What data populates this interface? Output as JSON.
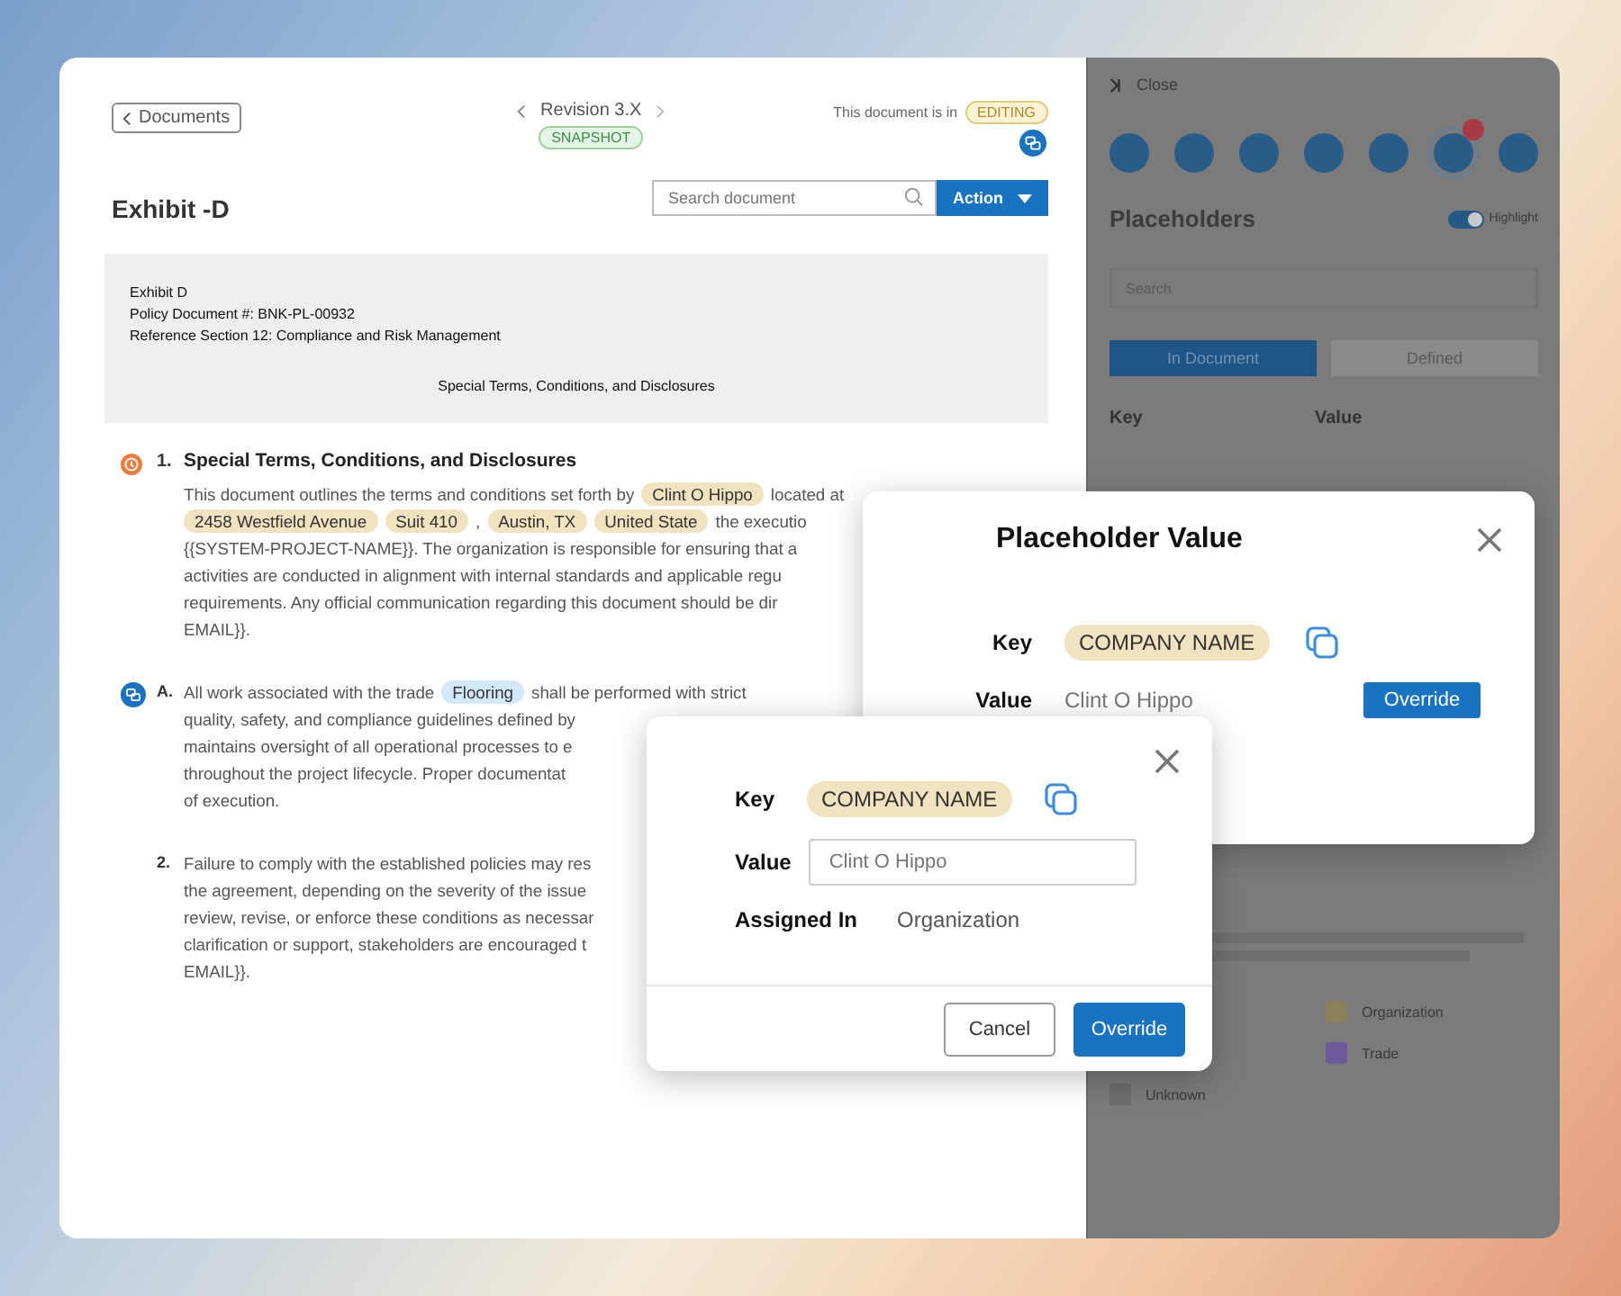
{
  "header": {
    "back_button": "Documents",
    "revision": "Revision 3.X",
    "revision_badge": "SNAPSHOT",
    "status_label": "This document is in",
    "status_badge": "EDITING",
    "title": "Exhibit -D",
    "search": {
      "placeholder": "Search document"
    },
    "action_button": "Action"
  },
  "preamble": {
    "lines": [
      "Exhibit D",
      "Policy Document #: BNK-PL-00932",
      "Reference Section 12: Compliance and Risk Management"
    ],
    "heading": "Special Terms, Conditions, and Disclosures"
  },
  "sections": [
    {
      "kind": "heading",
      "marker": "1.",
      "text": "Special Terms, Conditions, and Disclosures"
    },
    {
      "kind": "body",
      "lines": [
        [
          {
            "t": "This document outlines the terms and conditions set forth by"
          },
          {
            "chip": "Clint O Hippo",
            "color": "#f1e3bf"
          },
          {
            "t": "located at"
          }
        ],
        [
          {
            "chip": "2458 Westfield Avenue",
            "color": "#f1e3bf"
          },
          {
            "chip": "Suit 410",
            "color": "#f1e3bf"
          },
          {
            "t": ","
          },
          {
            "chip": "Austin, TX",
            "color": "#f1e3bf"
          },
          {
            "chip": "United State",
            "color": "#f1e3bf"
          },
          {
            "t": "the executio"
          }
        ],
        [
          {
            "t": "{{SYSTEM-PROJECT-NAME}}. The organization is responsible for ensuring that a"
          }
        ],
        [
          {
            "t": "activities are conducted in alignment with internal standards and applicable regu"
          }
        ],
        [
          {
            "t": "requirements. Any official communication regarding this document should be dir"
          }
        ],
        [
          {
            "t": "EMAIL}}."
          }
        ]
      ]
    },
    {
      "kind": "commented",
      "marker": "A.",
      "lines": [
        [
          {
            "t": "All work associated with the trade"
          },
          {
            "chip": "Flooring",
            "color": "#d3e9fb"
          },
          {
            "t": "shall be performed with strict"
          }
        ],
        [
          {
            "t": "quality, safety, and compliance guidelines defined by"
          }
        ],
        [
          {
            "t": "maintains oversight of all operational processes to e"
          }
        ],
        [
          {
            "t": "throughout the project lifecycle. Proper documentat"
          }
        ],
        [
          {
            "t": "of execution."
          }
        ]
      ]
    },
    {
      "kind": "numbered",
      "marker": "2.",
      "lines": [
        [
          {
            "t": "Failure to comply with the established policies may res"
          }
        ],
        [
          {
            "t": "the agreement, depending on the severity of the issue"
          }
        ],
        [
          {
            "t": "review, revise, or enforce these conditions as necessar"
          }
        ],
        [
          {
            "t": "clarification or support, stakeholders are encouraged t"
          }
        ],
        [
          {
            "t": "EMAIL}}."
          }
        ]
      ]
    }
  ],
  "sidebar": {
    "close": "Close",
    "tools": [
      {
        "selected": false,
        "badge": false
      },
      {
        "selected": false,
        "badge": false
      },
      {
        "selected": false,
        "badge": false
      },
      {
        "selected": false,
        "badge": false
      },
      {
        "selected": false,
        "badge": false
      },
      {
        "selected": true,
        "badge": true
      },
      {
        "selected": false,
        "badge": false
      }
    ],
    "title": "Placeholders",
    "highlight": {
      "label": "Highlight",
      "on": true
    },
    "search": {
      "placeholder": "Search"
    },
    "tabs": [
      {
        "label": "In Document",
        "selected": true
      },
      {
        "label": "Defined",
        "selected": false
      }
    ],
    "columns": [
      "Key",
      "Value"
    ],
    "legend": [
      {
        "label": "Organization",
        "color": "#8c7f5a"
      },
      {
        "label": "Trade",
        "color": "#6c5a9a"
      },
      {
        "label": "Unknown",
        "color": "#6e6e6e"
      }
    ]
  },
  "modal_back": {
    "title": "Placeholder Value",
    "key_label": "Key",
    "key": "COMPANY NAME",
    "value_label": "Value",
    "value": "Clint O Hippo",
    "override_button": "Override"
  },
  "modal_front": {
    "key_label": "Key",
    "key": "COMPANY NAME",
    "value_label": "Value",
    "value_placeholder": "Clint O Hippo",
    "assigned_label": "Assigned In",
    "assigned": "Organization",
    "cancel_button": "Cancel",
    "override_button": "Override"
  }
}
